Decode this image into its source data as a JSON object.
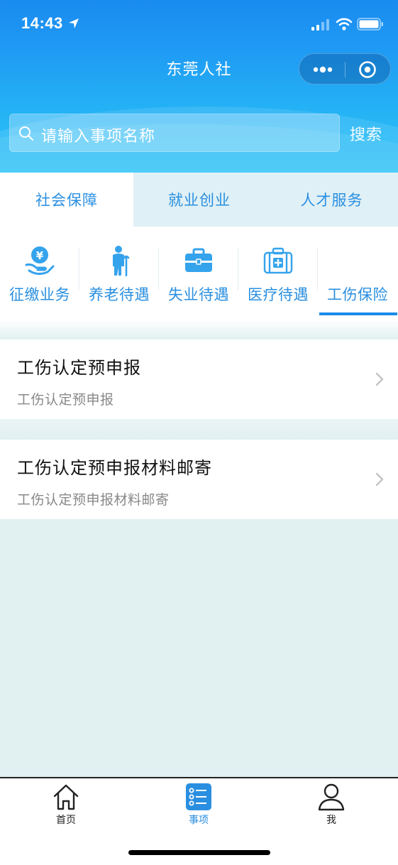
{
  "status_bar": {
    "time": "14:43"
  },
  "navbar": {
    "title": "东莞人社"
  },
  "search": {
    "placeholder": "请输入事项名称",
    "button_label": "搜索"
  },
  "main_tabs": [
    {
      "label": "社会保障",
      "active": true
    },
    {
      "label": "就业创业",
      "active": false
    },
    {
      "label": "人才服务",
      "active": false
    }
  ],
  "categories": [
    {
      "label": "征缴业务",
      "icon": "hand-yuan-icon",
      "active": false
    },
    {
      "label": "养老待遇",
      "icon": "elderly-icon",
      "active": false
    },
    {
      "label": "失业待遇",
      "icon": "briefcase-icon",
      "active": false
    },
    {
      "label": "医疗待遇",
      "icon": "medical-kit-icon",
      "active": false
    },
    {
      "label": "工伤保险",
      "icon": "",
      "active": true
    }
  ],
  "items": [
    {
      "title": "工伤认定预申报",
      "subtitle": "工伤认定预申报"
    },
    {
      "title": "工伤认定预申报材料邮寄",
      "subtitle": "工伤认定预申报材料邮寄"
    }
  ],
  "tabbar": [
    {
      "label": "首页",
      "icon": "home-icon",
      "active": false
    },
    {
      "label": "事项",
      "icon": "list-icon",
      "active": true
    },
    {
      "label": "我",
      "icon": "user-icon",
      "active": false
    }
  ],
  "colors": {
    "accent": "#2a8fe0",
    "header_top": "#1a8bf0",
    "header_bottom": "#2cc2f7",
    "page_bg": "#e1f0f1"
  }
}
